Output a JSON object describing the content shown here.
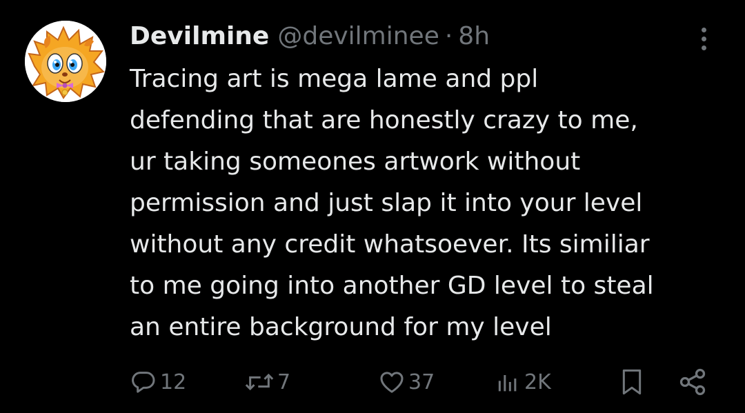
{
  "tweet": {
    "display_name": "Devilmine",
    "handle": "@devilminee",
    "separator": "·",
    "time": "8h",
    "avatar_icon": "cartoon-character-avatar",
    "body_lines": [
      "Tracing art is mega lame and ppl",
      "defending that are honestly crazy to me,",
      "ur taking someones artwork without",
      "permission and just slap it into your level",
      "without any credit whatsoever. Its similiar",
      "to me going into another GD level to steal",
      "an entire background for my level"
    ],
    "actions": {
      "replies": "12",
      "reposts": "7",
      "likes": "37",
      "views": "2K"
    }
  },
  "icons": {
    "reply": "reply-icon",
    "repost": "repost-icon",
    "like": "heart-icon",
    "views": "views-icon",
    "bookmark": "bookmark-icon",
    "share": "share-icon",
    "more": "more-icon"
  },
  "colors": {
    "background": "#000000",
    "text": "#e7e9ea",
    "muted": "#71767b"
  }
}
